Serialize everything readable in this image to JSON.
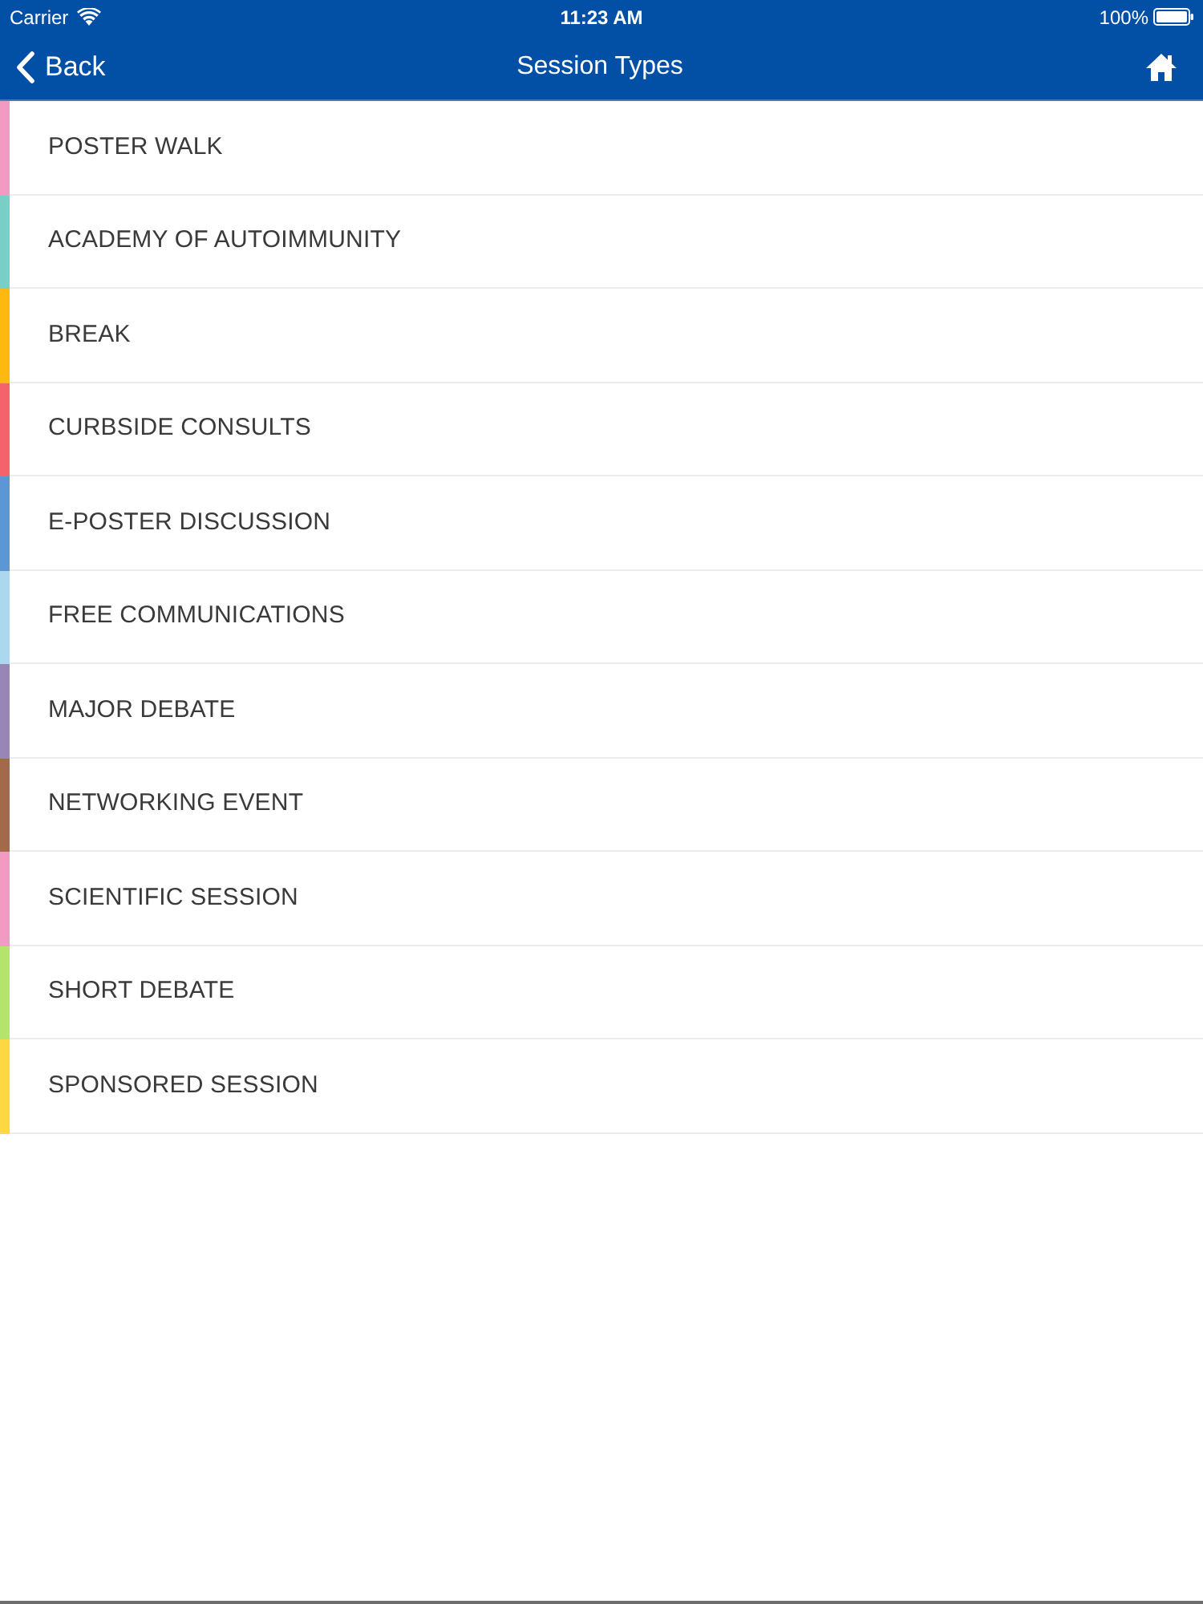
{
  "status_bar": {
    "carrier": "Carrier",
    "time": "11:23 AM",
    "battery": "100%"
  },
  "nav_bar": {
    "back": "Back",
    "title": "Session Types"
  },
  "session_types": [
    {
      "label": "POSTER WALK",
      "color": "#f29bc2"
    },
    {
      "label": "ACADEMY OF AUTOIMMUNITY",
      "color": "#78cfc6"
    },
    {
      "label": "BREAK",
      "color": "#fdb90f"
    },
    {
      "label": "CURBSIDE CONSULTS",
      "color": "#f4636a"
    },
    {
      "label": "E-POSTER DISCUSSION",
      "color": "#5b97d4"
    },
    {
      "label": "FREE COMMUNICATIONS",
      "color": "#acd8ef"
    },
    {
      "label": "MAJOR DEBATE",
      "color": "#9786b6"
    },
    {
      "label": "NETWORKING EVENT",
      "color": "#a2694b"
    },
    {
      "label": "SCIENTIFIC SESSION",
      "color": "#f29bc2"
    },
    {
      "label": "SHORT DEBATE",
      "color": "#b5e46c"
    },
    {
      "label": "SPONSORED SESSION",
      "color": "#fdd843"
    }
  ]
}
